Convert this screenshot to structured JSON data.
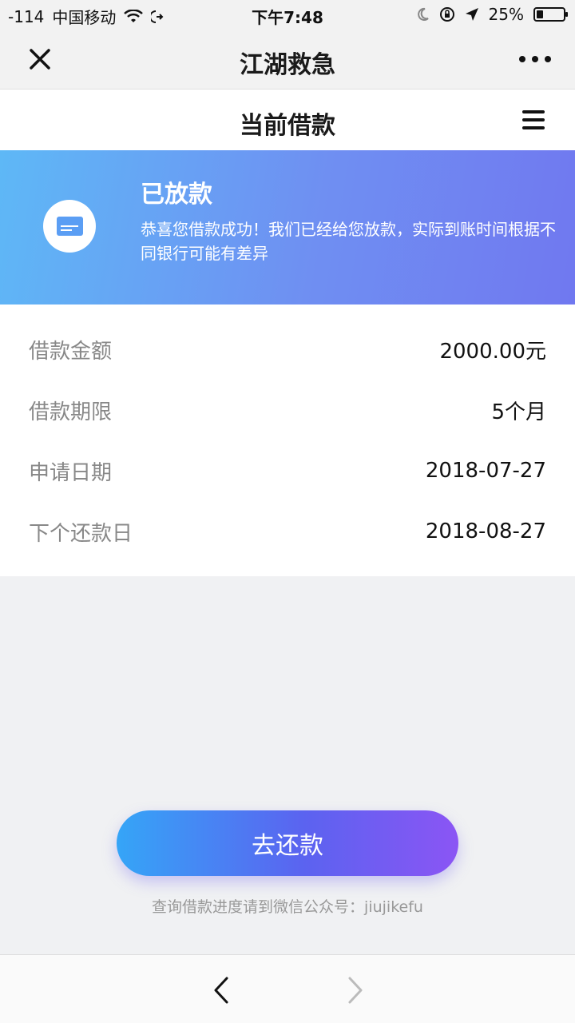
{
  "status_bar": {
    "signal": "-114",
    "carrier": "中国移动",
    "time": "下午7:48",
    "battery": "25%"
  },
  "nav": {
    "title": "江湖救急",
    "close_icon": "close-icon",
    "more_icon": "more-icon"
  },
  "header": {
    "title": "当前借款",
    "menu_icon": "menu-icon"
  },
  "banner": {
    "status": "已放款",
    "message": "恭喜您借款成功！我们已经给您放款，实际到账时间根据不同银行可能有差异",
    "icon": "card-icon",
    "gradient_start": "#5eb8f6",
    "gradient_end": "#7078f0"
  },
  "details": [
    {
      "label": "借款金额",
      "value": "2000.00元"
    },
    {
      "label": "借款期限",
      "value": "5个月"
    },
    {
      "label": "申请日期",
      "value": "2018-07-27"
    },
    {
      "label": "下个还款日",
      "value": "2018-08-27"
    }
  ],
  "action": {
    "button_label": "去还款",
    "hint": "查询借款进度请到微信公众号：jiujikefu"
  },
  "bottom_nav": {
    "back_icon": "chevron-left-icon",
    "forward_icon": "chevron-right-icon"
  }
}
